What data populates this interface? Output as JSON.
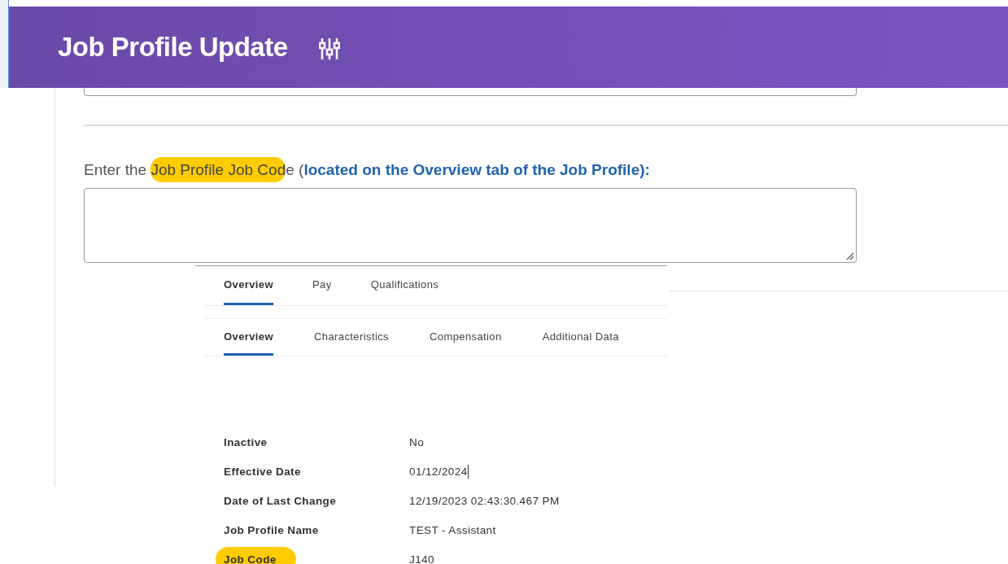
{
  "header": {
    "title": "Job Profile Update"
  },
  "question": {
    "segments": [
      {
        "text": "Enter the ",
        "kind": "plain"
      },
      {
        "text": "Job Profile Job Cod",
        "kind": "highlight"
      },
      {
        "text": "e (",
        "kind": "plain"
      },
      {
        "text": "located on the Overview tab of the Job Profile):",
        "kind": "emphasis"
      }
    ]
  },
  "profile_panel": {
    "tabs": [
      {
        "label": "Overview",
        "selected": true
      },
      {
        "label": "Pay",
        "selected": false
      },
      {
        "label": "Qualifications",
        "selected": false
      }
    ],
    "sub_tabs": [
      {
        "label": "Overview",
        "selected": true
      },
      {
        "label": "Characteristics",
        "selected": false
      },
      {
        "label": "Compensation",
        "selected": false
      },
      {
        "label": "Additional Data",
        "selected": false
      }
    ],
    "fields": [
      {
        "label": "Inactive",
        "value": "No",
        "highlighted": false,
        "caret": false
      },
      {
        "label": "Effective Date",
        "value": "01/12/2024",
        "highlighted": false,
        "caret": true
      },
      {
        "label": "Date of Last Change",
        "value": "12/19/2023 02:43:30.467 PM",
        "highlighted": false,
        "caret": false
      },
      {
        "label": "Job Profile Name",
        "value": "TEST - Assistant",
        "highlighted": false,
        "caret": false
      },
      {
        "label": "Job Code",
        "value": "J140",
        "highlighted": true,
        "caret": false
      }
    ]
  }
}
